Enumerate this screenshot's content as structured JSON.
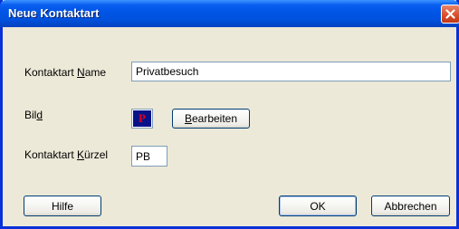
{
  "window": {
    "title": "Neue Kontaktart",
    "close_symbol": "close-icon"
  },
  "form": {
    "name_label_pre": "Kontaktart ",
    "name_label_key": "N",
    "name_label_post": "ame",
    "name_value": "Privatbesuch",
    "bild_label_pre": "Bil",
    "bild_label_key": "d",
    "bild_icon_letter": "P",
    "edit_label_key": "B",
    "edit_label_post": "earbeiten",
    "kuerzel_label_pre": "Kontaktart ",
    "kuerzel_label_key": "K",
    "kuerzel_label_post": "ürzel",
    "kuerzel_value": "PB"
  },
  "buttons": {
    "help": "Hilfe",
    "ok": "OK",
    "cancel": "Abbrechen"
  },
  "colors": {
    "titlebar": "#0055e5",
    "close_button": "#d9512c",
    "dialog_bg": "#ece9d8",
    "bild_bg": "#06128a",
    "bild_letter": "#e0001a"
  }
}
